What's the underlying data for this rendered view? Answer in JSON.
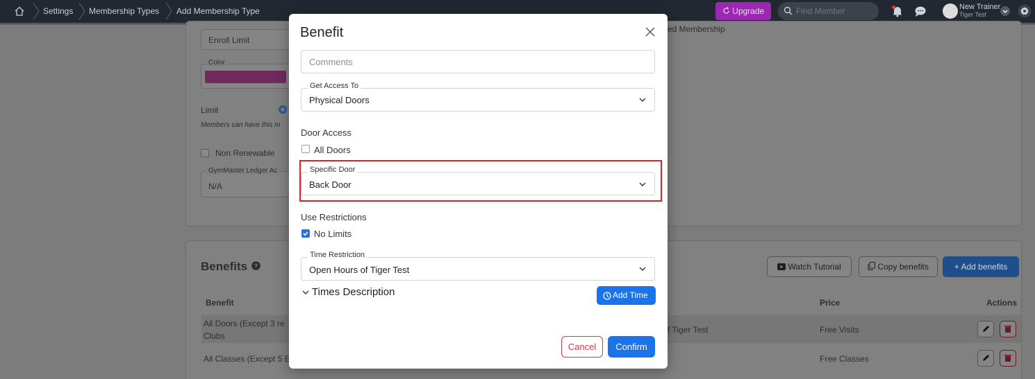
{
  "topbar": {
    "breadcrumbs": [
      "Settings",
      "Membership Types",
      "Add Membership Type"
    ],
    "upgrade_label": "Upgrade",
    "search_placeholder": "Find Member",
    "user_name": "New Trainer",
    "user_org": "Tiger Test"
  },
  "background": {
    "enroll_limit_placeholder": "Enroll Limit",
    "color_label": "Color",
    "color_value": "#c2259a",
    "limit_label": "Limit",
    "limit_hint": "Members can have this m",
    "non_renewable_label": "Non Renewable",
    "ledger_label": "GymMaster Ledger Ac",
    "ledger_value": "N/A",
    "membership_fragment": "ed Membership",
    "benefits_title": "Benefits",
    "watch_tutorial": "Watch Tutorial",
    "copy_benefits": "Copy benefits",
    "add_benefits": "+ Add benefits",
    "table": {
      "headers": [
        "Benefit",
        "Price",
        "Actions"
      ],
      "rows": [
        {
          "benefit_line1": "All Doors (Except 3 re",
          "benefit_line2": "Clubs",
          "time": "f Tiger Test",
          "price": "Free Visits"
        },
        {
          "benefit_line1": "All Classes (Except 5 E",
          "benefit_line2": "",
          "time": "",
          "price": "Free Classes"
        }
      ]
    }
  },
  "modal": {
    "title": "Benefit",
    "comments_placeholder": "Comments",
    "get_access_label": "Get Access To",
    "get_access_value": "Physical Doors",
    "door_access_label": "Door Access",
    "all_doors_label": "All Doors",
    "all_doors_checked": false,
    "specific_door_label": "Specific Door",
    "specific_door_value": "Back Door",
    "use_restrictions_label": "Use Restrictions",
    "no_limits_label": "No Limits",
    "no_limits_checked": true,
    "time_restriction_label": "Time Restriction",
    "time_restriction_value": "Open Hours of Tiger Test",
    "times_description_label": "Times Description",
    "add_time_label": "Add Time",
    "cancel_label": "Cancel",
    "confirm_label": "Confirm"
  },
  "colors": {
    "accent": "#1a73e8",
    "danger": "#dc3545",
    "upgrade": "#9c27b0",
    "highlight": "#e02020"
  }
}
